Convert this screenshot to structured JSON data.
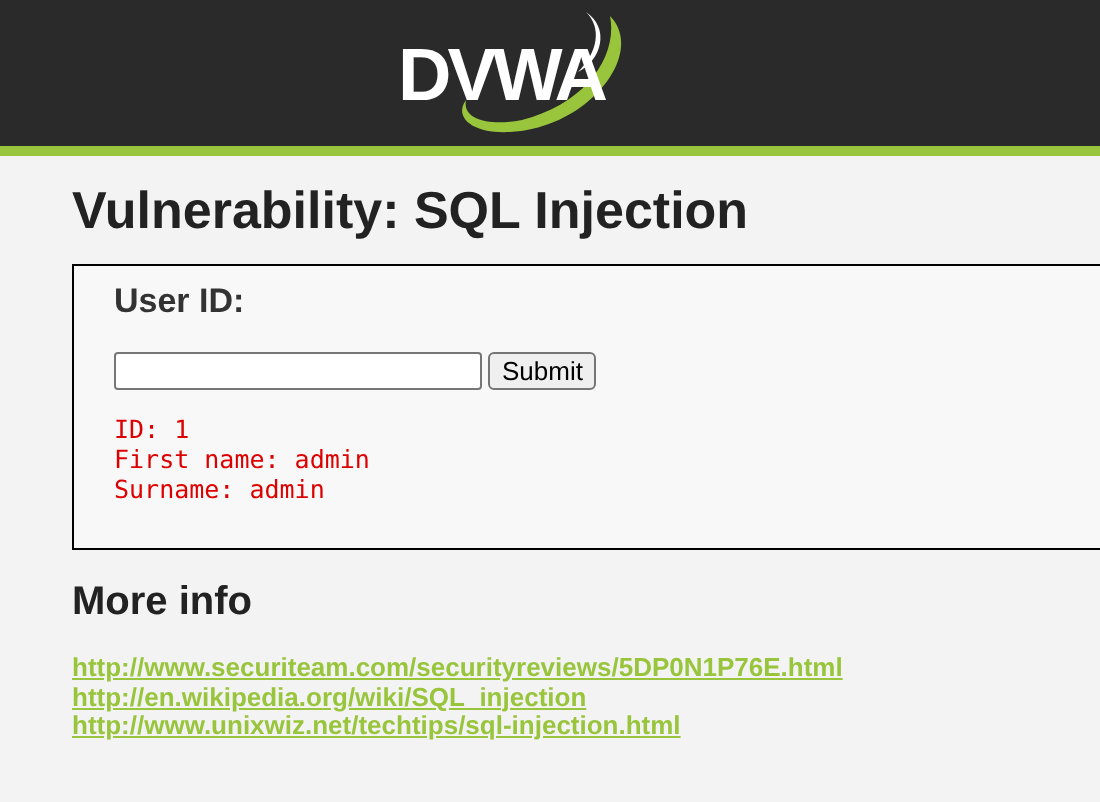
{
  "header": {
    "logo": "DVWA"
  },
  "title": "Vulnerability: SQL Injection",
  "form": {
    "label": "User ID:",
    "button": "Submit",
    "output": [
      "ID: 1",
      "First name: admin",
      "Surname: admin"
    ]
  },
  "more_info": {
    "heading": "More info",
    "links": [
      "http://www.securiteam.com/securityreviews/5DP0N1P76E.html",
      "http://en.wikipedia.org/wiki/SQL_injection",
      "http://www.unixwiz.net/techtips/sql-injection.html"
    ]
  }
}
